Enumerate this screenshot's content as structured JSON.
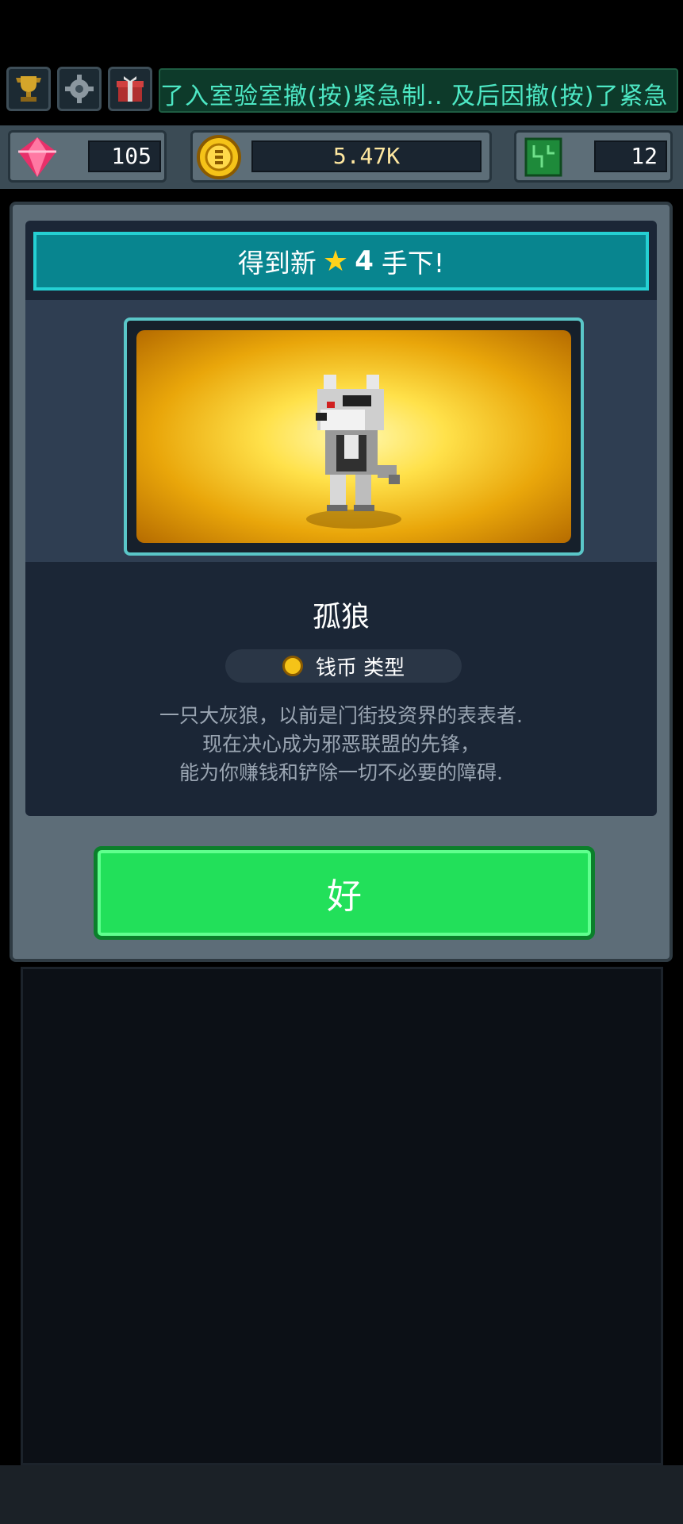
{
  "topbar": {
    "ticker_text": "了入室验室撤(按)紧急制.. 及后因撤(按)了紧急",
    "icons": [
      "trophy-icon",
      "gear-icon",
      "gift-icon"
    ]
  },
  "resources": {
    "gems": "105",
    "coins": "5.47K",
    "chips": "12"
  },
  "dialog": {
    "title_prefix": "得到新",
    "star_count": "4",
    "title_suffix": "手下!",
    "minion_name": "孤狼",
    "type_label": "钱币 类型",
    "description": [
      "一只大灰狼，以前是门街投资界的表表者.",
      "现在决心成为邪恶联盟的先锋，",
      "能为你赚钱和铲除一切不必要的障碍."
    ],
    "ok_label": "好"
  },
  "colors": {
    "banner": "#08858f",
    "ok_button": "#22e05a",
    "coin": "#f5c318",
    "gem": "#e8306a"
  }
}
